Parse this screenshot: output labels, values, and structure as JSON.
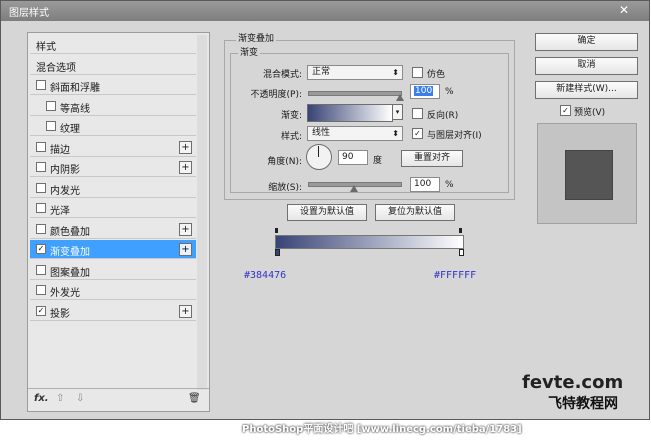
{
  "window": {
    "title": "图层样式",
    "close": "✕"
  },
  "left_list": {
    "items": [
      {
        "label": "样式",
        "checkbox": false,
        "indent": 0,
        "checked": false,
        "plus": false,
        "selected": false
      },
      {
        "label": "混合选项",
        "checkbox": false,
        "indent": 0,
        "checked": false,
        "plus": false,
        "selected": false
      },
      {
        "label": "斜面和浮雕",
        "checkbox": true,
        "indent": 0,
        "checked": false,
        "plus": false,
        "selected": false
      },
      {
        "label": "等高线",
        "checkbox": true,
        "indent": 1,
        "checked": false,
        "plus": false,
        "selected": false
      },
      {
        "label": "纹理",
        "checkbox": true,
        "indent": 1,
        "checked": false,
        "plus": false,
        "selected": false
      },
      {
        "label": "描边",
        "checkbox": true,
        "indent": 0,
        "checked": false,
        "plus": true,
        "selected": false
      },
      {
        "label": "内阴影",
        "checkbox": true,
        "indent": 0,
        "checked": false,
        "plus": true,
        "selected": false
      },
      {
        "label": "内发光",
        "checkbox": true,
        "indent": 0,
        "checked": false,
        "plus": false,
        "selected": false
      },
      {
        "label": "光泽",
        "checkbox": true,
        "indent": 0,
        "checked": false,
        "plus": false,
        "selected": false
      },
      {
        "label": "颜色叠加",
        "checkbox": true,
        "indent": 0,
        "checked": false,
        "plus": true,
        "selected": false
      },
      {
        "label": "渐变叠加",
        "checkbox": true,
        "indent": 0,
        "checked": true,
        "plus": true,
        "selected": true
      },
      {
        "label": "图案叠加",
        "checkbox": true,
        "indent": 0,
        "checked": false,
        "plus": false,
        "selected": false
      },
      {
        "label": "外发光",
        "checkbox": true,
        "indent": 0,
        "checked": false,
        "plus": false,
        "selected": false
      },
      {
        "label": "投影",
        "checkbox": true,
        "indent": 0,
        "checked": true,
        "plus": true,
        "selected": false
      }
    ],
    "footer": {
      "fx": "fx.",
      "up": "⇧",
      "down": "⇩",
      "trash": "🗑"
    }
  },
  "gradient_overlay": {
    "section_title": "渐变叠加",
    "group_title": "渐变",
    "blend_mode_label": "混合模式:",
    "blend_mode_value": "正常",
    "dither_label": "仿色",
    "opacity_label": "不透明度(P):",
    "opacity_value": "100",
    "opacity_unit": "%",
    "opacity_level": 1.0,
    "gradient_label": "渐变:",
    "reverse_label": "反向(R)",
    "style_label": "样式:",
    "style_value": "线性",
    "align_label": "与图层对齐(I)",
    "angle_label": "角度(N):",
    "angle_value": "90",
    "angle_unit": "度",
    "reset_align_button": "重置对齐",
    "scale_label": "缩放(S):",
    "scale_value": "100",
    "scale_unit": "%",
    "scale_level": 0.5,
    "make_default_button": "设置为默认值",
    "reset_default_button": "复位为默认值"
  },
  "gradient_editor": {
    "start_color": "#384476",
    "end_color": "#FFFFFF",
    "start_color_text": "#384476",
    "end_color_text": "#FFFFFF"
  },
  "right_buttons": {
    "ok": "确定",
    "cancel": "取消",
    "new_style": "新建样式(W)...",
    "preview_label": "预览(V)"
  },
  "colors": {
    "selection": "#3fa0ff",
    "preview_swatch": "#555555",
    "hex_text": "#3333cc"
  },
  "watermark": {
    "site": "fevte.com",
    "site_cn": "飞特教程网",
    "caption": "PhotoShop平面设计吧  [www.linecg.com/tieba/1783]"
  }
}
